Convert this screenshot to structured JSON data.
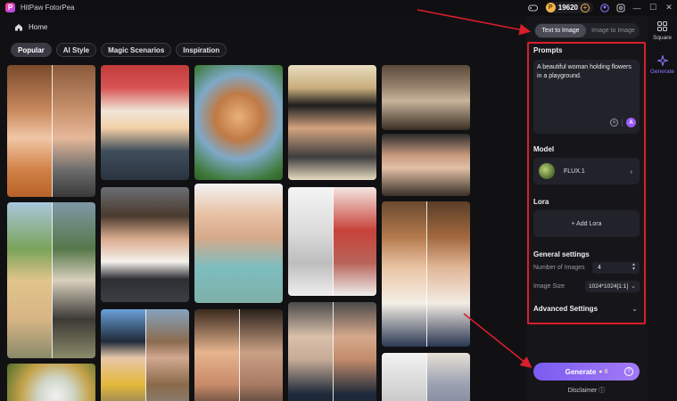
{
  "titlebar": {
    "app_title": "HitPaw FotorPea",
    "coins": "19620",
    "icons": [
      "gamepad-icon",
      "coin-icon",
      "add-coins-icon",
      "user-icon",
      "sync-icon",
      "minimize-icon",
      "maximize-icon",
      "close-icon"
    ]
  },
  "home": {
    "label": "Home"
  },
  "filters": [
    {
      "label": "Popular",
      "active": true
    },
    {
      "label": "AI Style",
      "active": false
    },
    {
      "label": "Magic Scenarios",
      "active": false
    },
    {
      "label": "Inspiration",
      "active": false
    }
  ],
  "mode_tabs": [
    {
      "label": "Text to Image",
      "active": true
    },
    {
      "label": "Image to Image",
      "active": false
    }
  ],
  "prompts": {
    "title": "Prompts",
    "value": "A beautiful woman holding flowers in a playground."
  },
  "model": {
    "title": "Model",
    "name": "FLUX.1"
  },
  "lora": {
    "title": "Lora",
    "add_label": "+ Add Lora"
  },
  "general": {
    "title": "General settings",
    "num_images_label": "Number of Images",
    "num_images_value": "4",
    "image_size_label": "Image Size",
    "image_size_value": "1024*1024[1:1]"
  },
  "advanced": {
    "title": "Advanced Settings"
  },
  "generate": {
    "label": "Generate",
    "cost": "8"
  },
  "disclaimer": {
    "label": "Disclaimer"
  },
  "rail": [
    {
      "label": "Square",
      "icon": "grid-icon",
      "active": false
    },
    {
      "label": "Generate",
      "icon": "sparkle-icon",
      "active": true
    }
  ],
  "colors": {
    "accent": "#8c7bff",
    "highlight_box": "#d91e2a",
    "generate_gradient_start": "#7b5cf0",
    "generate_gradient_end": "#a27af7"
  }
}
